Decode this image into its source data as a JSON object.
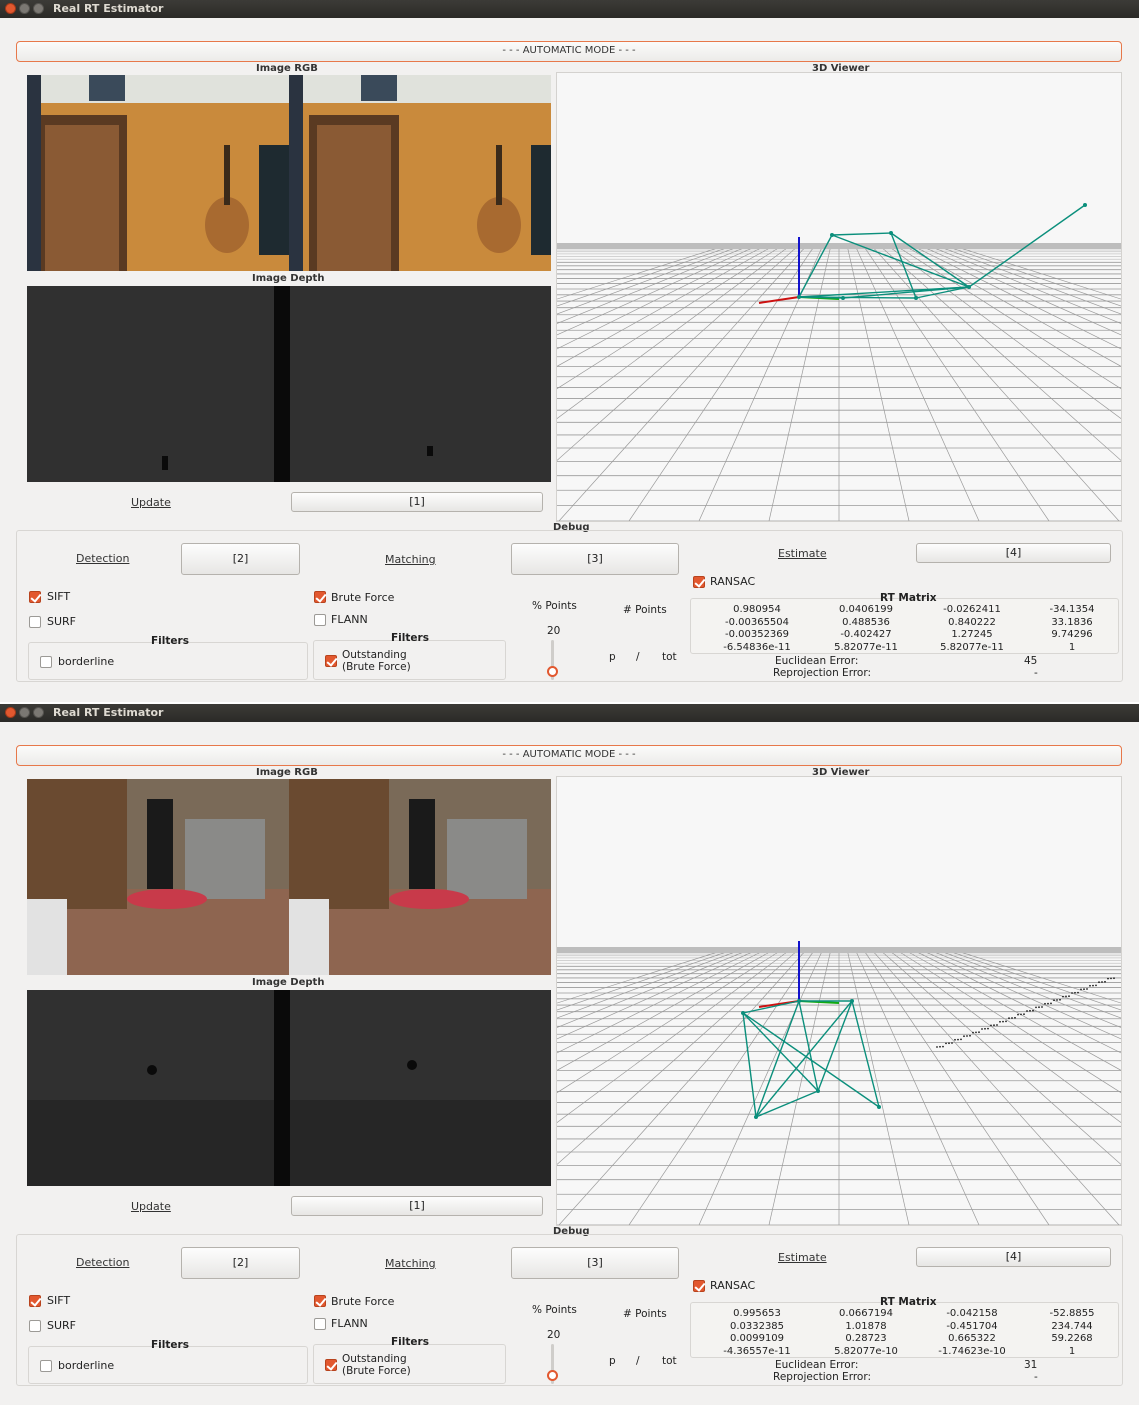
{
  "windows": [
    {
      "title": "Real RT Estimator",
      "mode_label": "- - - AUTOMATIC MODE - - -",
      "image_rgb_label": "Image RGB",
      "image_depth_label": "Image Depth",
      "viewer_label": "3D Viewer",
      "update_label": "Update",
      "btn1": "[1]",
      "debug_label": "Debug",
      "detection_label": "Detection",
      "btn2": "[2]",
      "matching_label": "Matching",
      "btn3": "[3]",
      "estimate_label": "Estimate",
      "btn4": "[4]",
      "sift_label": "SIFT",
      "surf_label": "SURF",
      "filters_label": "Filters",
      "borderline_label": "borderline",
      "brute_force_label": "Brute Force",
      "flann_label": "FLANN",
      "outstanding_label": "Outstanding",
      "outstanding_sub": "(Brute Force)",
      "pct_points_label": "% Points",
      "num_points_label": "# Points",
      "pct_value": "20",
      "p_label": "p",
      "slash_label": "/",
      "tot_label": "tot",
      "ransac_label": "RANSAC",
      "rt_matrix_label": "RT Matrix",
      "matrix": [
        [
          "0.980954",
          "0.0406199",
          "-0.0262411",
          "-34.1354"
        ],
        [
          "-0.00365504",
          "0.488536",
          "0.840222",
          "33.1836"
        ],
        [
          "-0.00352369",
          "-0.402427",
          "1.27245",
          "9.74296"
        ],
        [
          "-6.54836e-11",
          "5.82077e-11",
          "5.82077e-11",
          "1"
        ]
      ],
      "euclidean_label": "Euclidean Error:",
      "euclidean_value": "45",
      "reprojection_label": "Reprojection Error:",
      "reprojection_value": "-",
      "state": {
        "sift": true,
        "surf": false,
        "borderline": false,
        "brute_force": true,
        "flann": false,
        "outstanding": true,
        "ransac": true
      }
    },
    {
      "title": "Real RT Estimator",
      "mode_label": "- - - AUTOMATIC MODE - - -",
      "image_rgb_label": "Image RGB",
      "image_depth_label": "Image Depth",
      "viewer_label": "3D Viewer",
      "update_label": "Update",
      "btn1": "[1]",
      "debug_label": "Debug",
      "detection_label": "Detection",
      "btn2": "[2]",
      "matching_label": "Matching",
      "btn3": "[3]",
      "estimate_label": "Estimate",
      "btn4": "[4]",
      "sift_label": "SIFT",
      "surf_label": "SURF",
      "filters_label": "Filters",
      "borderline_label": "borderline",
      "brute_force_label": "Brute Force",
      "flann_label": "FLANN",
      "outstanding_label": "Outstanding",
      "outstanding_sub": "(Brute Force)",
      "pct_points_label": "% Points",
      "num_points_label": "# Points",
      "pct_value": "20",
      "p_label": "p",
      "slash_label": "/",
      "tot_label": "tot",
      "ransac_label": "RANSAC",
      "rt_matrix_label": "RT Matrix",
      "matrix": [
        [
          "0.995653",
          "0.0667194",
          "-0.042158",
          "-52.8855"
        ],
        [
          "0.0332385",
          "1.01878",
          "-0.451704",
          "234.744"
        ],
        [
          "0.0099109",
          "0.28723",
          "0.665322",
          "59.2268"
        ],
        [
          "-4.36557e-11",
          "5.82077e-10",
          "-1.74623e-10",
          "1"
        ]
      ],
      "euclidean_label": "Euclidean Error:",
      "euclidean_value": "31",
      "reprojection_label": "Reprojection Error:",
      "reprojection_value": "-",
      "state": {
        "sift": true,
        "surf": false,
        "borderline": false,
        "brute_force": true,
        "flann": false,
        "outstanding": true,
        "ransac": true
      }
    }
  ],
  "colors": {
    "accent": "#e2582f",
    "trajectory": "#0b8f7c",
    "titlebar": "#2b2a27"
  }
}
